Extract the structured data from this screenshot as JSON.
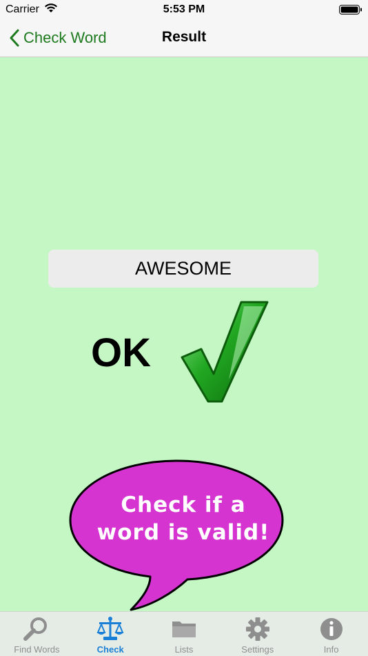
{
  "status_bar": {
    "carrier": "Carrier",
    "time": "5:53 PM"
  },
  "nav": {
    "back_label": "Check Word",
    "title": "Result"
  },
  "result": {
    "word": "AWESOME",
    "verdict": "OK",
    "valid": true
  },
  "bubble": {
    "line1": "Check if a",
    "line2": "word is valid!"
  },
  "tabs": [
    {
      "label": "Find Words",
      "icon": "magnifier-icon",
      "active": false
    },
    {
      "label": "Check",
      "icon": "scales-icon",
      "active": true
    },
    {
      "label": "Lists",
      "icon": "folder-icon",
      "active": false
    },
    {
      "label": "Settings",
      "icon": "gear-icon",
      "active": false
    },
    {
      "label": "Info",
      "icon": "info-icon",
      "active": false
    }
  ],
  "colors": {
    "background": "#c4f7c4",
    "accent_green": "#1e7a1e",
    "check_green": "#149614",
    "bubble_magenta": "#d534d1",
    "tab_active": "#1a7fd6",
    "tab_inactive": "#8e8e8e"
  }
}
